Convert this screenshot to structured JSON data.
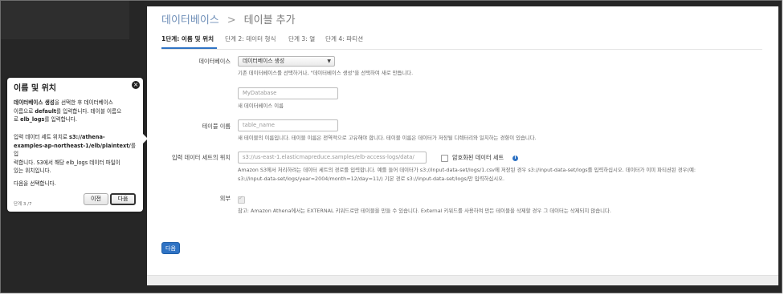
{
  "breadcrumb": {
    "parent": "데이터베이스",
    "separator": ">",
    "current": "테이블 추가"
  },
  "tabs": [
    {
      "label": "1단계: 이름 및 위치",
      "active": true
    },
    {
      "label": "단계 2: 데이터 형식",
      "active": false
    },
    {
      "label": "단계 3: 열",
      "active": false
    },
    {
      "label": "단계 4: 파티션",
      "active": false
    }
  ],
  "form": {
    "database": {
      "label": "데이터베이스",
      "selected": "데이터베이스 생성",
      "help": "기존 데이터베이스를 선택하거나, \"데이터베이스 생성\"을 선택하여 새로 만듭니다.",
      "new_placeholder": "MyDatabase",
      "new_help": "새 데이터베이스 이름"
    },
    "table": {
      "label": "테이블 이름",
      "placeholder": "table_name",
      "help": "새 테이블의 이름입니다. 테이블 이름은 전역적으로 고유해야 합니다. 테이블 이름은 데이터가 저장될 디렉터리와 일치하는 경향이 있습니다."
    },
    "location": {
      "label": "입력 데이터 세트의 위치",
      "placeholder": "s3://us-east-1.elasticmapreduce.samples/elb-access-logs/data/",
      "encrypted_label": "암호화된 데이터 세트",
      "help_line1": "Amazon S3에서 처리하려는 데이터 세트의 경로를 입력합니다. 예를 들어 데이터가 s3://input-data-set/logs/1.csv에 저장된 경우 s3://input-data-set/logs를 입력하십시오. 데이터가 이미 파티션된 경우(예:",
      "help_line2": "s3://input-data-set/logs/year=2004/month=12/day=11/) 기본 경로 s3://input-data-set/logs/만 입력하십시오."
    },
    "external": {
      "label": "외부",
      "note": "참고: Amazon Athena에서는 EXTERNAL 키워드로만 테이블을 만들 수 있습니다. External 키워드를 사용하여 만든 테이블을 삭제할 경우 그 데이터는 삭제되지 않습니다."
    },
    "next_button": "다음"
  },
  "popover": {
    "title": "이름 및 위치",
    "close_icon": "×",
    "para1_lines": [
      "데이터베이스 생성을 선택한 후 데이터베이스",
      "이름으로 default를 입력합니다. 테이블 이름으",
      "로 elb_logs를 입력합니다."
    ],
    "para2_lines": [
      "입력 데이터 세트 위치로 s3://athena-",
      "examples-ap-northeast-1/elb/plaintext/를 입",
      "력합니다. S3에서 해당 elb_logs 데이터 파일이",
      "있는 위치입니다."
    ],
    "para3": "다음을 선택합니다.",
    "step": "단계 3 /7",
    "prev_button": "이전",
    "next_button": "다음"
  },
  "colors": {
    "primary": "#2f73c4",
    "breadcrumb_link": "#6f8fb8",
    "overlay": "#262626"
  }
}
